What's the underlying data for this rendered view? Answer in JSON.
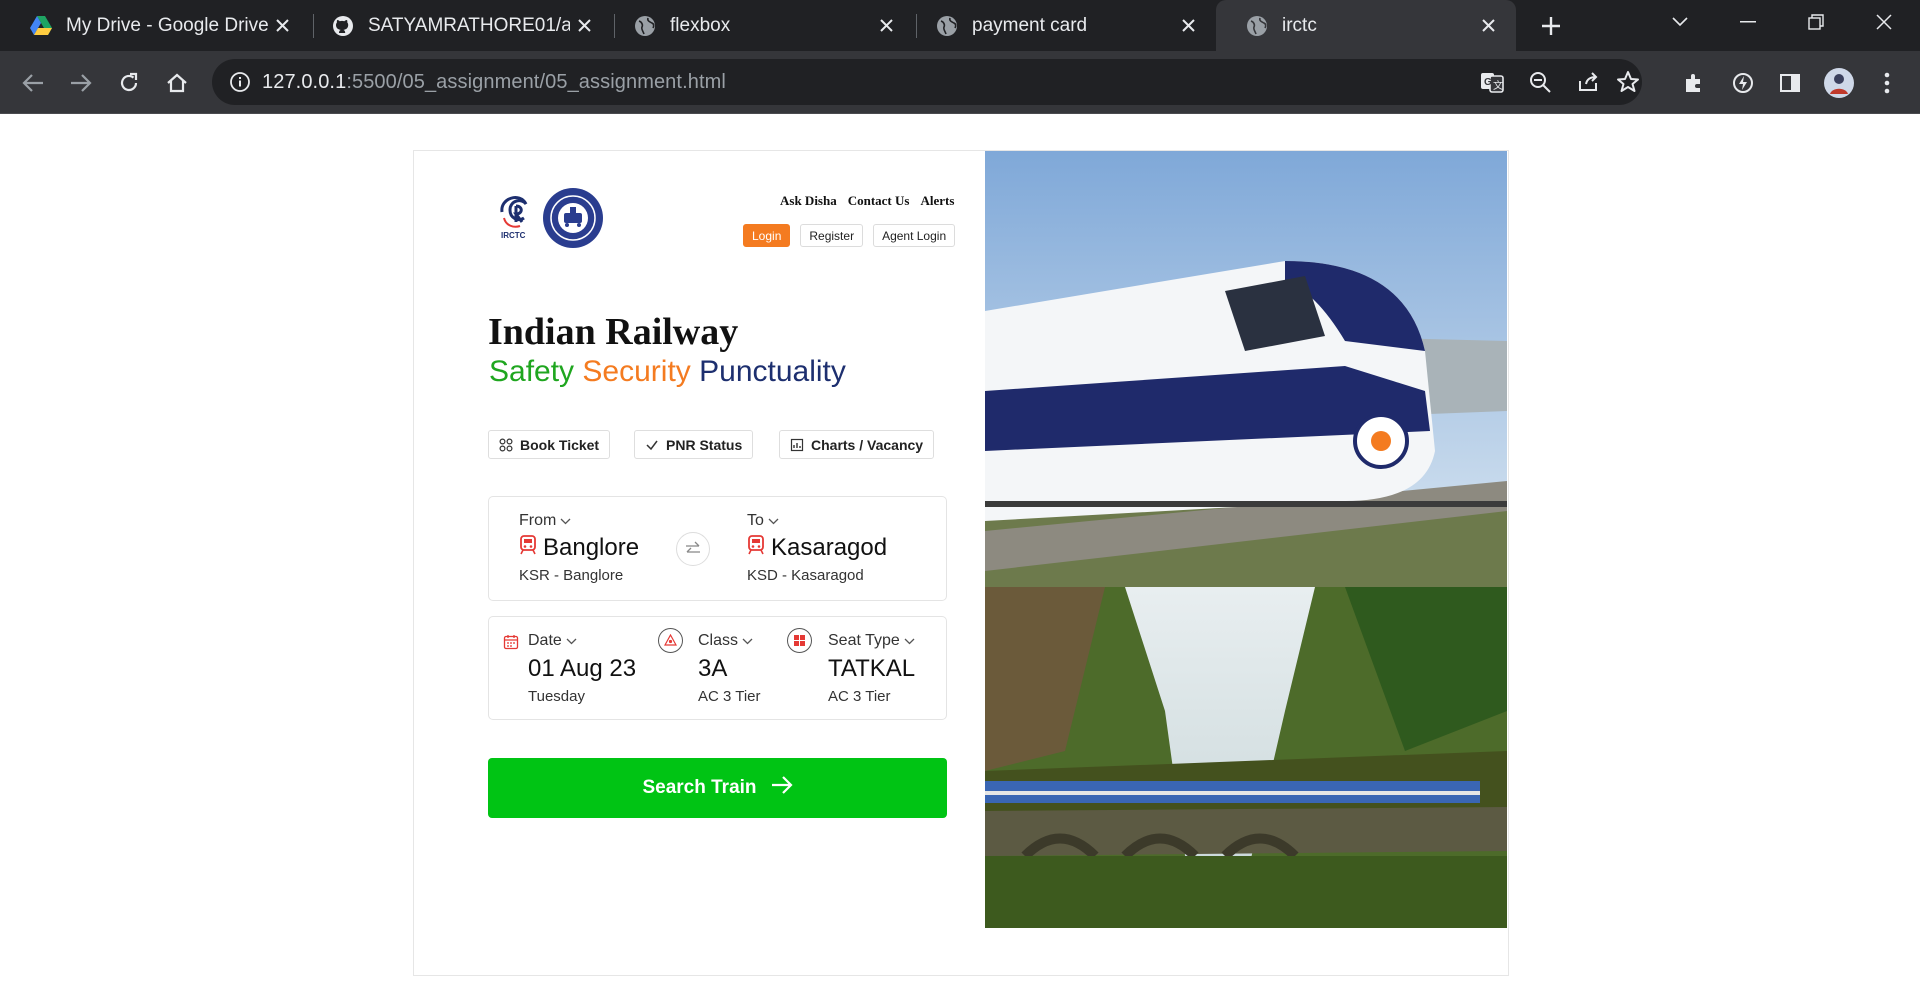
{
  "browser": {
    "tabs": [
      {
        "title": "My Drive - Google Drive",
        "icon": "google-drive-icon"
      },
      {
        "title": "SATYAMRATHORE01/assi",
        "icon": "github-icon"
      },
      {
        "title": "flexbox",
        "icon": "globe-icon"
      },
      {
        "title": "payment card",
        "icon": "globe-icon"
      },
      {
        "title": "irctc",
        "icon": "globe-icon",
        "active": true
      }
    ],
    "url_host": "127.0.0.1",
    "url_path": ":5500/05_assignment/05_assignment.html"
  },
  "header": {
    "links": [
      "Ask Disha",
      "Contact Us",
      "Alerts"
    ],
    "login_label": "Login",
    "register_label": "Register",
    "agent_login_label": "Agent Login"
  },
  "hero_text": {
    "title": "Indian Railway",
    "tag1": "Safety",
    "tag2": "Security",
    "tag3": "Punctuality"
  },
  "modes": {
    "book_ticket": "Book Ticket",
    "pnr_status": "PNR Status",
    "charts_vacancy": "Charts / Vacancy"
  },
  "route": {
    "from_label": "From",
    "from_city": "Banglore",
    "from_code": "KSR - Banglore",
    "to_label": "To",
    "to_city": "Kasaragod",
    "to_code": "KSD - Kasaragod"
  },
  "journey": {
    "date_label": "Date",
    "date_value": "01 Aug 23",
    "date_day": "Tuesday",
    "class_label": "Class",
    "class_value": "3A",
    "class_sub": "AC 3 Tier",
    "seat_label": "Seat Type",
    "seat_value": "TATKAL",
    "seat_sub": "AC 3 Tier"
  },
  "search_label": "Search Train",
  "colors": {
    "accent_orange": "#f47b20",
    "green": "#00c414",
    "navy": "#1d2f6f"
  }
}
